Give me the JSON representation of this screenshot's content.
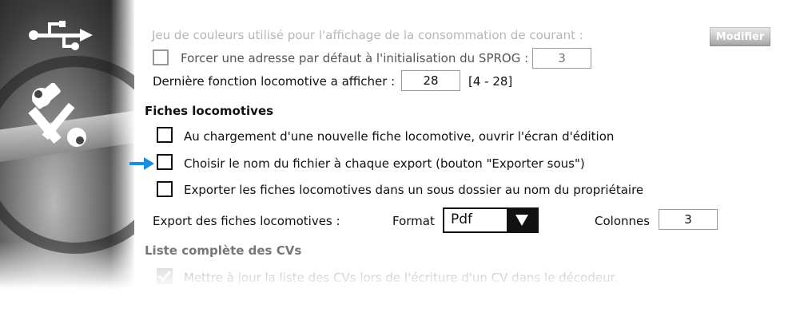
{
  "top": {
    "couleurs_label": "Jeu de couleurs utilisé pour l'affichage de la consommation de courant :",
    "modifier_label": "Modifier",
    "forcer_label": "Forcer une adresse par défaut à l'initialisation du SPROG :",
    "forcer_value": "3",
    "derniere_label": "Dernière fonction locomotive a afficher :",
    "derniere_value": "28",
    "derniere_range": "[4 - 28]"
  },
  "fiches": {
    "title": "Fiches locomotives",
    "opt1": "Au chargement d'une nouvelle fiche locomotive, ouvrir l'écran d'édition",
    "opt2": "Choisir le nom du fichier à chaque export (bouton \"Exporter sous\")",
    "opt3": "Exporter les fiches locomotives dans un sous dossier au nom du propriétaire",
    "export_label": "Export des fiches locomotives :",
    "format_label": "Format",
    "format_value": "Pdf",
    "colonnes_label": "Colonnes",
    "colonnes_value": "3"
  },
  "cvs": {
    "title": "Liste complète des CVs",
    "opt1": "Mettre à jour la liste des CVs lors de l'écriture d'un CV dans le décodeur."
  },
  "icons": {
    "usb": "usb-icon",
    "tools": "tools-icon",
    "pointer": "arrow-right-icon",
    "dropdown": "triangle-down-icon",
    "check": "check-icon"
  },
  "colors": {
    "accent_arrow": "#1a8fe0",
    "dim_text": "#9a9a9a"
  }
}
